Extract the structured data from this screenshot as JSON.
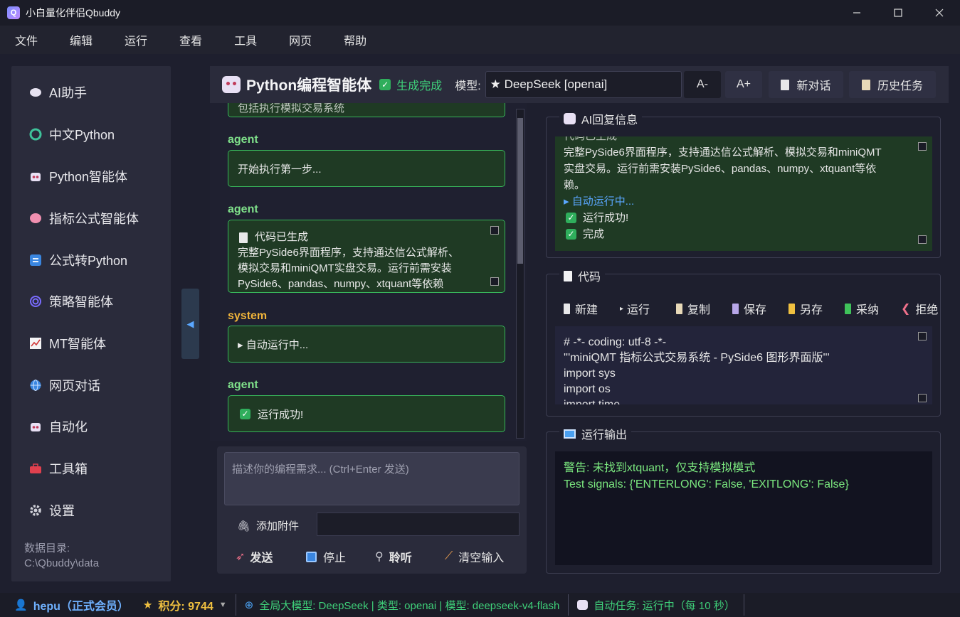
{
  "window": {
    "title": "小白量化伴侣Qbuddy",
    "app_logo": "Q"
  },
  "menu": [
    "文件",
    "编辑",
    "运行",
    "查看",
    "工具",
    "网页",
    "帮助"
  ],
  "sidebar": {
    "items": [
      {
        "label": "AI助手",
        "icon": "chat-bubble-icon"
      },
      {
        "label": "中文Python",
        "icon": "python-icon"
      },
      {
        "label": "Python智能体",
        "icon": "robot-icon"
      },
      {
        "label": "指标公式智能体",
        "icon": "brain-icon"
      },
      {
        "label": "公式转Python",
        "icon": "convert-icon"
      },
      {
        "label": "策略智能体",
        "icon": "spiral-icon"
      },
      {
        "label": "MT智能体",
        "icon": "chart-icon"
      },
      {
        "label": "网页对话",
        "icon": "globe-icon"
      },
      {
        "label": "自动化",
        "icon": "robot-icon"
      },
      {
        "label": "工具箱",
        "icon": "toolbox-icon"
      },
      {
        "label": "设置",
        "icon": "gear-icon"
      }
    ],
    "data_dir_label": "数据目录:",
    "data_dir_path": "C:\\Qbuddy\\data"
  },
  "header": {
    "title": "Python编程智能体",
    "status": "生成完成",
    "model_label": "模型:",
    "model_value": "★ DeepSeek [openai]",
    "font_minus": "A-",
    "font_plus": "A+",
    "new_chat": "新对话",
    "history": "历史任务"
  },
  "chat": {
    "partial_top": "包括执行模拟交易系统",
    "messages": [
      {
        "role": "agent",
        "text": "开始执行第一步..."
      },
      {
        "role": "agent",
        "title": "代码已生成",
        "lines": [
          "完整PySide6界面程序，支持通达信公式解析、",
          "模拟交易和miniQMT实盘交易。运行前需安装",
          "PySide6、pandas、numpy、xtquant等依赖"
        ]
      },
      {
        "role": "system",
        "text": "▸ 自动运行中..."
      },
      {
        "role": "agent",
        "text": "运行成功!"
      }
    ]
  },
  "input": {
    "placeholder": "描述你的编程需求... (Ctrl+Enter 发送)",
    "attach_label": "添加附件",
    "send": "发送",
    "stop": "停止",
    "listen": "聆听",
    "clear": "清空输入"
  },
  "ai_reply": {
    "title": "AI回复信息",
    "partial_top": "代码已生成",
    "lines": [
      "完整PySide6界面程序，支持通达信公式解析、模拟交易和miniQMT",
      "实盘交易。运行前需安装PySide6、pandas、numpy、xtquant等依",
      "赖。"
    ],
    "running": "▸ 自动运行中...",
    "success": "运行成功!",
    "done": "完成"
  },
  "code": {
    "title": "代码",
    "tools": [
      "新建",
      "运行",
      "复制",
      "保存",
      "另存",
      "采纳",
      "拒绝"
    ],
    "lines": [
      "# -*- coding: utf-8 -*-",
      "'''miniQMT 指标公式交易系统 - PySide6 图形界面版'''",
      "import sys",
      "import os",
      "import time"
    ]
  },
  "output": {
    "title": "运行输出",
    "lines": [
      "警告: 未找到xtquant，仅支持模拟模式",
      "Test signals: {'ENTERLONG': False, 'EXITLONG': False}"
    ]
  },
  "statusbar": {
    "user": "hepu（正式会员）",
    "points": "积分: 9744",
    "model_info": "全局大模型: DeepSeek | 类型: openai | 模型: deepseek-v4-flash",
    "auto_task": "自动任务: 运行中（每 10 秒）"
  },
  "colors": {
    "accent_green": "#3fd17a",
    "bubble_bg": "#1f3a24",
    "bubble_border": "#38b55a",
    "system_label": "#f0b43a",
    "link_blue": "#5aa7ff"
  }
}
